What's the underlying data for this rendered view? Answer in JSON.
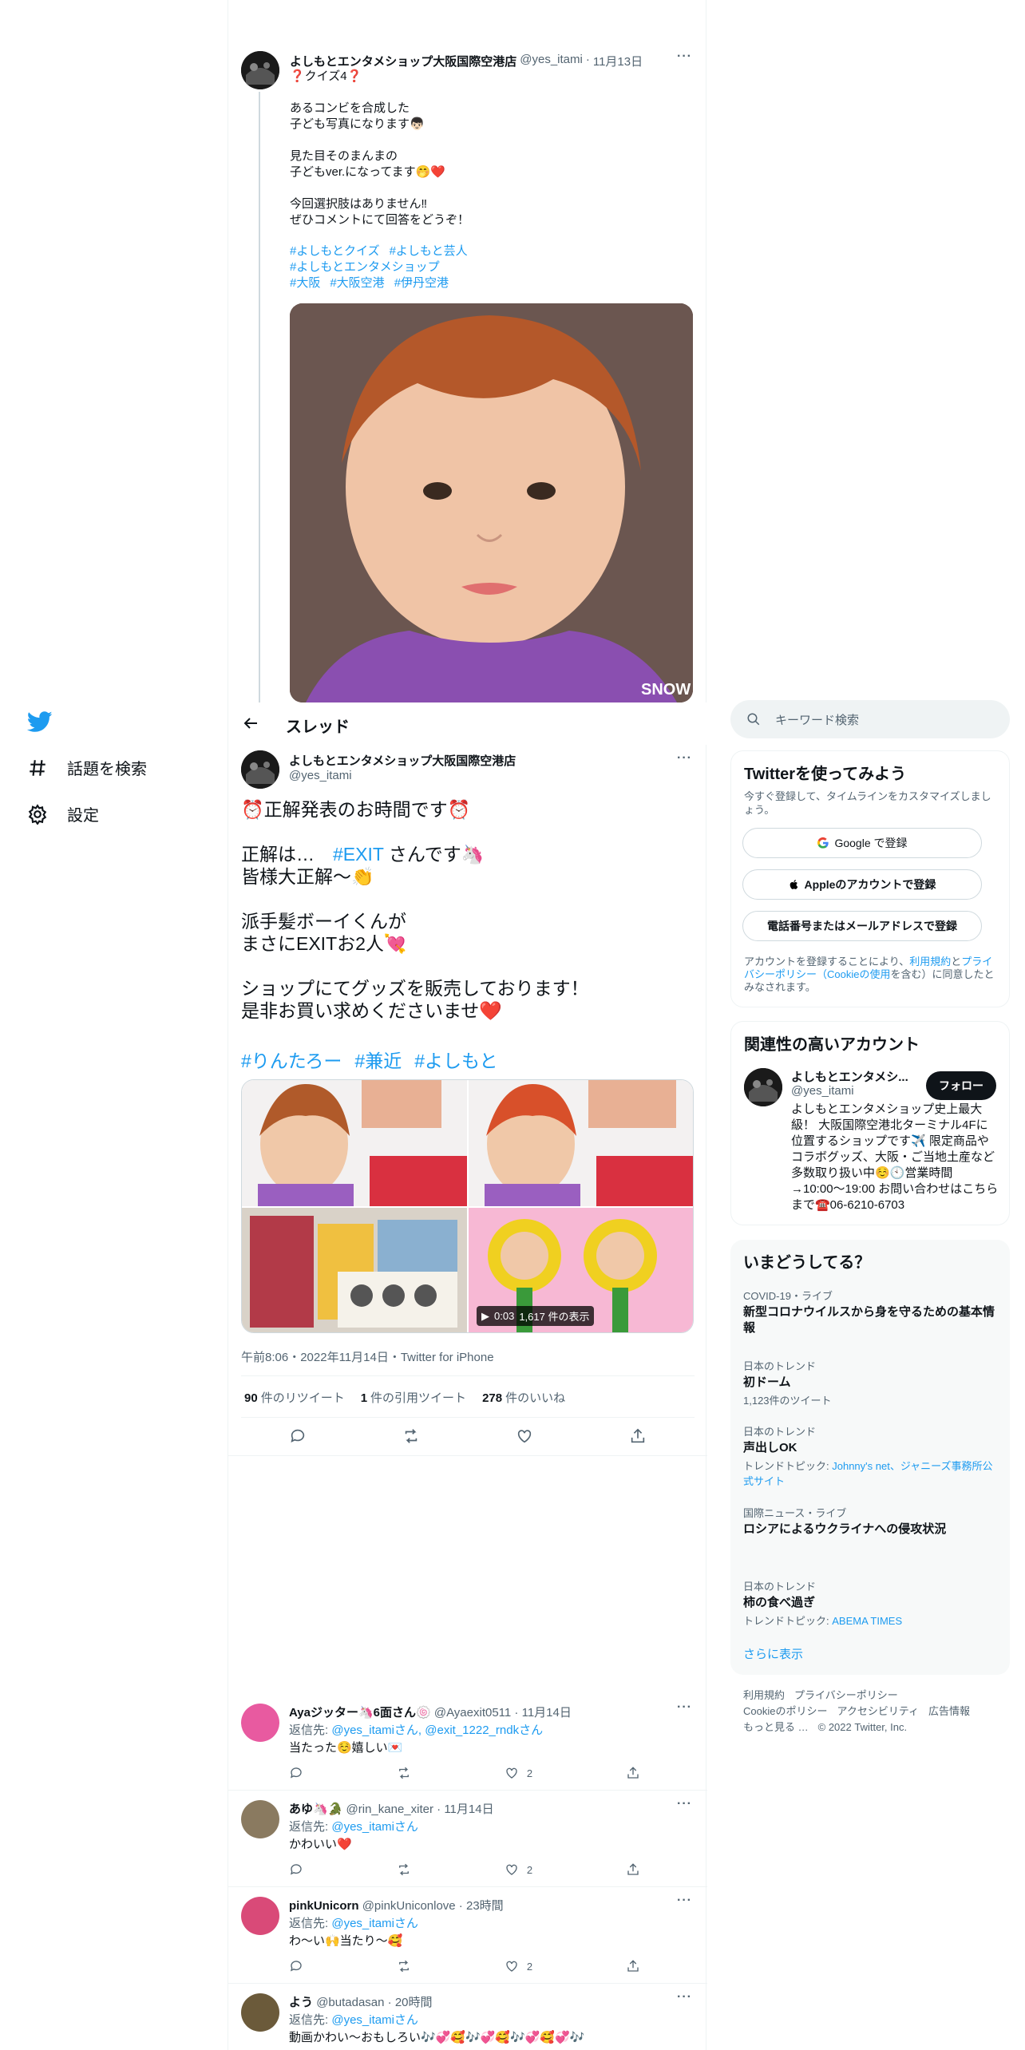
{
  "nav": {
    "items": [
      {
        "label": "話題を検索",
        "icon": "hashtag-icon"
      },
      {
        "label": "設定",
        "icon": "gear-icon"
      }
    ]
  },
  "prev_tweet": {
    "name": "よしもとエンタメショップ大阪国際空港店",
    "handle": "@yes_itami",
    "date": "11月13日",
    "title": "❓クイズ4❓",
    "body": "あるコンビを合成した\n子ども写真になります👦🏻\n\n見た目そのまんまの\n子どもver.になってます🤭❤️\n\n今回選択肢はありません‼︎\nぜひコメントにて回答をどうぞ！",
    "tags": [
      [
        "#よしもとクイズ",
        "#よしもと芸人"
      ],
      [
        "#よしもとエンタメショップ"
      ],
      [
        "#大阪",
        "#大阪空港",
        "#伊丹空港"
      ]
    ],
    "photo_watermark": "SNOW"
  },
  "thread": {
    "title": "スレッド"
  },
  "main_tweet": {
    "name": "よしもとエンタメショップ大阪国際空港店",
    "handle": "@yes_itami",
    "body_1": "⏰正解発表のお時間です⏰\n\n正解は…　",
    "mention_tag": "#EXIT",
    "body_2": " さんです🦄\n皆様大正解〜👏\n\n派手髪ボーイくんが\nまさにEXITお2人💘\n\nショップにてグッズを販売しております！\n是非お買い求めくださいませ❤️",
    "tags": [
      "#りんたろー",
      "#兼近",
      "#よしもと"
    ],
    "video_duration": "0:03",
    "video_views": "1,617 件の表示",
    "meta": "午前8:06・2022年11月14日・Twitter for iPhone",
    "stats": [
      {
        "num": "90",
        "label": "件のリツイート"
      },
      {
        "num": "1",
        "label": "件の引用ツイート"
      },
      {
        "num": "278",
        "label": "件のいいね"
      }
    ]
  },
  "replies": [
    {
      "name": "Ayaジッター🦄6面さん🍥",
      "handle": "@Ayaexit0511",
      "date": "11月14日",
      "replyto_prefix": "返信先: ",
      "replyto": "@yes_itamiさん, @exit_1222_rndkさん",
      "text": "当たった☺️嬉しい💌",
      "likes": "2",
      "avatar_color": "#e85aa0"
    },
    {
      "name": "あゆ🦄🐊",
      "handle": "@rin_kane_xiter",
      "date": "11月14日",
      "replyto_prefix": "返信先: ",
      "replyto": "@yes_itamiさん",
      "text": "かわいい❤️",
      "likes": "2",
      "avatar_color": "#8a7a60"
    },
    {
      "name": "pinkUnicorn",
      "handle": "@pinkUniconlove",
      "date": "23時間",
      "replyto_prefix": "返信先: ",
      "replyto": "@yes_itamiさん",
      "text": "わ～い🙌当たり～🥰",
      "likes": "2",
      "avatar_color": "#d94a78"
    },
    {
      "name": "よう",
      "handle": "@butadasan",
      "date": "20時間",
      "replyto_prefix": "返信先: ",
      "replyto": "@yes_itamiさん",
      "text": "動画かわい〜おもしろい🎶💞🥰🎶💞🥰🎶💞🥰💞🎶",
      "likes": "",
      "avatar_color": "#6b5a3a"
    }
  ],
  "search": {
    "placeholder": "キーワード検索"
  },
  "signup": {
    "title": "Twitterを使ってみよう",
    "desc": "今すぐ登録して、タイムラインをカスタマイズしましょう。",
    "google": "Google で登録",
    "apple": "Appleのアカウントで登録",
    "phone": "電話番号またはメールアドレスで登録",
    "terms_1": "アカウントを登録することにより、",
    "terms_link1": "利用規約",
    "terms_2": "と",
    "terms_link2": "プライバシーポリシー（Cookieの使用",
    "terms_3": "を含む）に同意したとみなされます。"
  },
  "related": {
    "title": "関連性の高いアカウント",
    "name": "よしもとエンタメシ...",
    "handle": "@yes_itami",
    "follow": "フォロー",
    "bio": "よしもとエンタメショップ史上最大級！ 大阪国際空港北ターミナル4Fに位置するショップです✈️ 限定商品やコラボグッズ、大阪・ご当地土産など多数取り扱い中☺️🕙営業時間→10:00〜19:00 お問い合わせはこちらまで☎️06-6210-6703"
  },
  "trends": {
    "title": "いまどうしてる？",
    "items": [
      {
        "ctx": "COVID-19・ライブ",
        "title": "新型コロナウイルスから身を守るための基本情報",
        "sub": "",
        "link": ""
      },
      {
        "ctx": "日本のトレンド",
        "title": "初ドーム",
        "sub": "1,123件のツイート",
        "link": ""
      },
      {
        "ctx": "日本のトレンド",
        "title": "声出しOK",
        "sub": "トレンドトピック: ",
        "link": "Johnny's net、ジャニーズ事務所公式サイト"
      },
      {
        "ctx": "国際ニュース・ライブ",
        "title": "ロシアによるウクライナへの侵攻状況",
        "sub": "",
        "link": ""
      },
      {
        "ctx": "日本のトレンド",
        "title": "柿の食べ過ぎ",
        "sub": "トレンドトピック: ",
        "link": "ABEMA TIMES"
      }
    ],
    "more": "さらに表示"
  },
  "footer": {
    "row1": [
      "利用規約",
      "プライバシーポリシー"
    ],
    "row2": [
      "Cookieのポリシー",
      "アクセシビリティ",
      "広告情報"
    ],
    "row3": [
      "もっと見る …",
      "© 2022 Twitter, Inc."
    ]
  },
  "colors": {
    "accent": "#1d9bf0",
    "text": "#0f1419",
    "muted": "#536471"
  }
}
